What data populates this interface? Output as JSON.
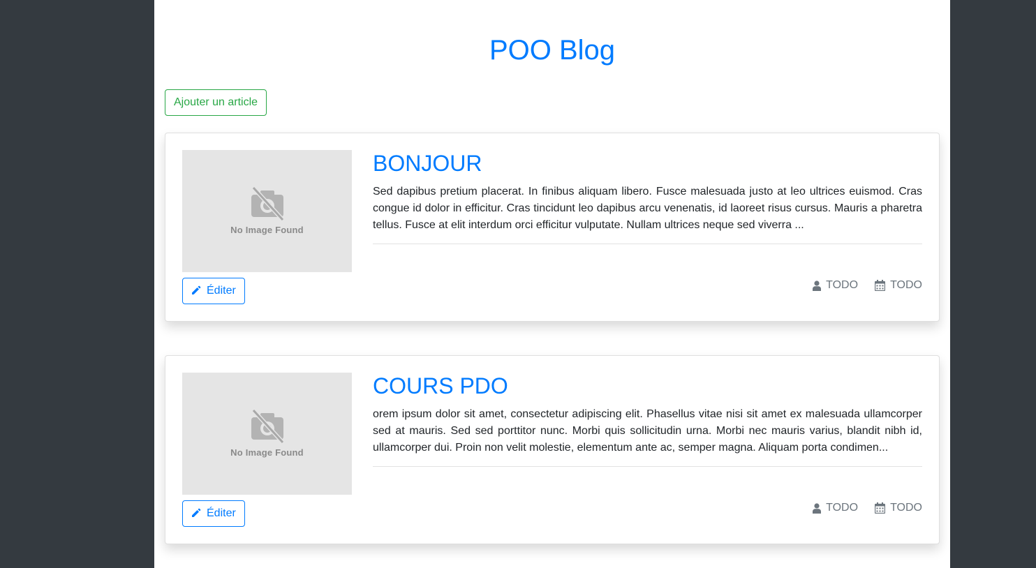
{
  "colors": {
    "primary": "#007bff",
    "success": "#28a745",
    "muted": "#6c757d",
    "background": "#343a40"
  },
  "header": {
    "title": "POO Blog"
  },
  "actions": {
    "add_article": "Ajouter un article"
  },
  "articles": [
    {
      "title": "BONJOUR",
      "excerpt": "Sed dapibus pretium placerat. In finibus aliquam libero. Fusce malesuada justo at leo ultrices euismod. Cras congue id dolor in efficitur. Cras tincidunt leo dapibus arcu venenatis, id laoreet risus cursus. Mauris a pharetra tellus. Fusce at elit interdum orci efficitur vulputate. Nullam ultrices neque sed viverra ...",
      "image_placeholder": "No Image Found",
      "edit_label": "Éditer",
      "author": "TODO",
      "date": "TODO",
      "icons": {
        "edit": "pencil-icon",
        "author": "user-icon",
        "date": "calendar-icon"
      }
    },
    {
      "title": "COURS PDO",
      "excerpt": "orem ipsum dolor sit amet, consectetur adipiscing elit. Phasellus vitae nisi sit amet ex malesuada ullamcorper sed at mauris. Sed sed porttitor nunc. Morbi quis sollicitudin urna. Morbi nec mauris varius, blandit nibh id, ullamcorper dui. Proin non velit molestie, elementum ante ac, semper magna. Aliquam porta condimen...",
      "image_placeholder": "No Image Found",
      "edit_label": "Éditer",
      "author": "TODO",
      "date": "TODO",
      "icons": {
        "edit": "pencil-icon",
        "author": "user-icon",
        "date": "calendar-icon"
      }
    }
  ]
}
